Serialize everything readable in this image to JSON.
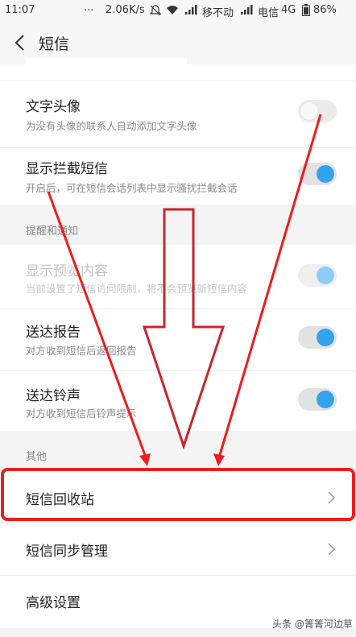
{
  "status_bar": {
    "time": "11:07",
    "dots": "...",
    "speed": "2.06K/s",
    "carrier1": "移不动",
    "carrier2": "电信",
    "network": "4G",
    "battery": "86%"
  },
  "header": {
    "title": "短信"
  },
  "settings": {
    "avatar": {
      "title": "文字头像",
      "subtitle": "为没有头像的联系人自动添加文字头像",
      "enabled": false
    },
    "blocked": {
      "title": "显示拦截短信",
      "subtitle": "开启后，可在短信会话列表中显示骚扰拦截会话",
      "enabled": true
    }
  },
  "notifications": {
    "label": "提醒和通知",
    "preview": {
      "title": "显示预览内容",
      "subtitle": "当前设置了短信访问限制，将不会预览新短信内容",
      "enabled": true,
      "disabled": true
    },
    "delivery_report": {
      "title": "送达报告",
      "subtitle": "对方收到短信后返回报告",
      "enabled": true
    },
    "delivery_tone": {
      "title": "送达铃声",
      "subtitle": "对方收到短信后铃声提示",
      "enabled": true
    }
  },
  "other": {
    "label": "其他",
    "recycle_bin": "短信回收站",
    "sync": "短信同步管理",
    "advanced": "高级设置"
  },
  "watermark": "头条 @箐箐河边草",
  "colors": {
    "accent": "#33a3f0",
    "annotation": "#ee1c1c"
  }
}
